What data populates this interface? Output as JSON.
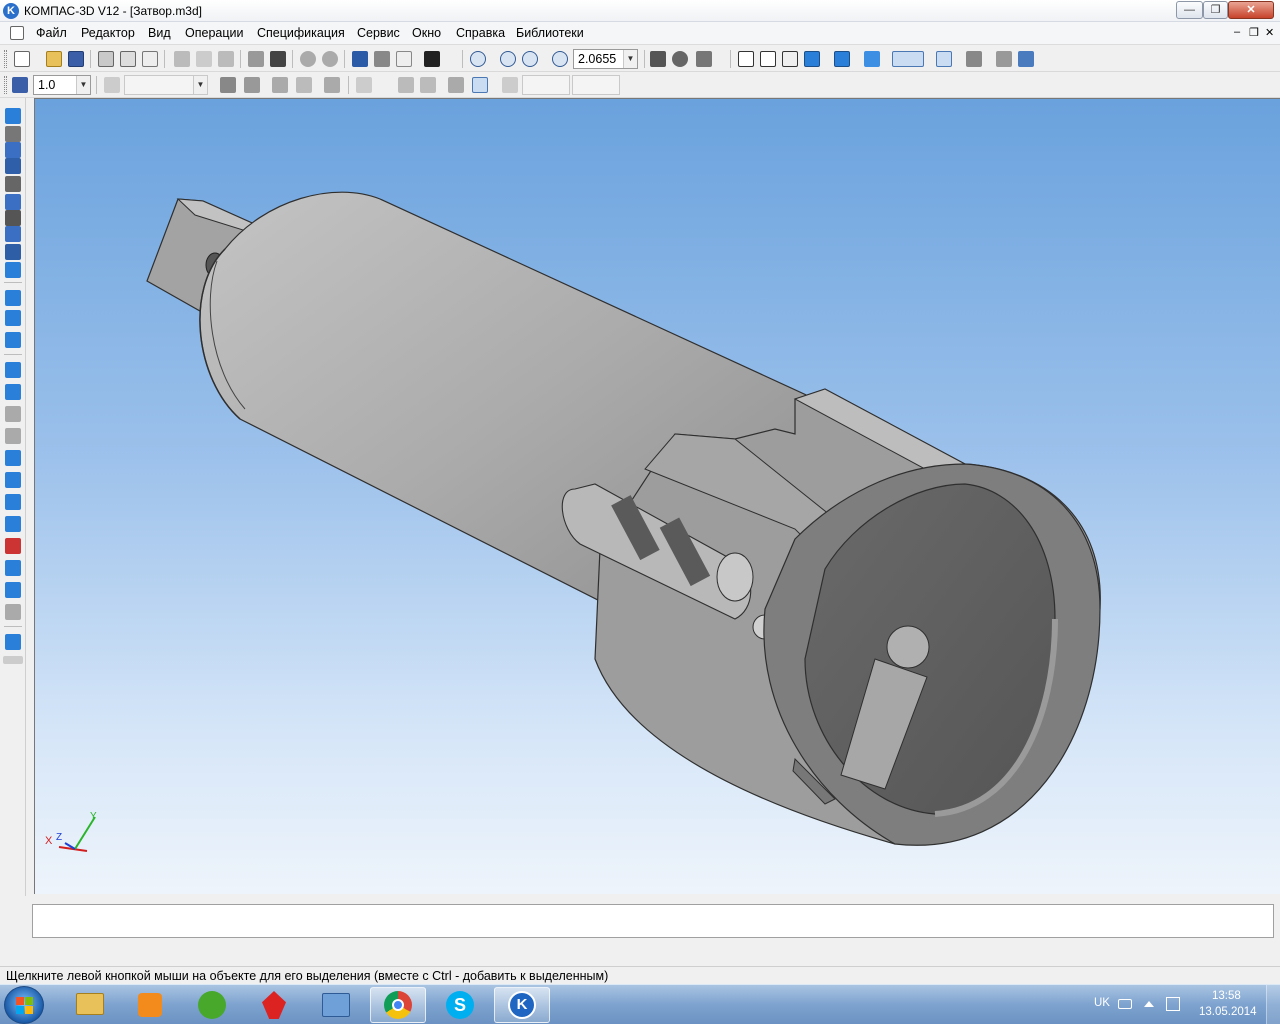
{
  "window": {
    "title": "КОМПАС-3D V12 - [Затвор.m3d]",
    "app_icon_letter": "K",
    "controls": {
      "minimize": "—",
      "maximize": "❐",
      "close": "✕"
    }
  },
  "menu": {
    "items": [
      "Файл",
      "Редактор",
      "Вид",
      "Операции",
      "Спецификация",
      "Сервис",
      "Окно",
      "Справка",
      "Библиотеки"
    ],
    "mdi_controls": {
      "minimize": "–",
      "restore": "❐",
      "close": "✕"
    }
  },
  "toolbar_main": {
    "zoom_value": "2.0655"
  },
  "toolbar_secondary": {
    "step_value": "1.0",
    "layer_value": "",
    "coord_x": "",
    "coord_y": ""
  },
  "viewport": {
    "axis_labels": {
      "x": "X",
      "y": "Y",
      "z": "Z"
    }
  },
  "status": {
    "hint": "Щелкните левой кнопкой мыши на объекте для его выделения (вместе с Ctrl - добавить к выделенным)"
  },
  "taskbar": {
    "apps": [
      {
        "name": "explorer",
        "icon": "folder-icon"
      },
      {
        "name": "media-player",
        "icon": "media-icon"
      },
      {
        "name": "utorrent",
        "icon": "utorrent-icon"
      },
      {
        "name": "windmill",
        "icon": "windmill-icon"
      },
      {
        "name": "remote",
        "icon": "remote-icon"
      },
      {
        "name": "chrome",
        "icon": "chrome-icon"
      },
      {
        "name": "skype",
        "icon": "skype-icon"
      },
      {
        "name": "kompas",
        "icon": "kompas-icon"
      }
    ],
    "language": "UK",
    "time": "13:58",
    "date": "13.05.2014"
  },
  "colors": {
    "viewport_top": "#6aa2dd",
    "viewport_bottom": "#eef4fb",
    "model_body": "#a9a9a9",
    "model_shadow": "#5e5e5e"
  }
}
